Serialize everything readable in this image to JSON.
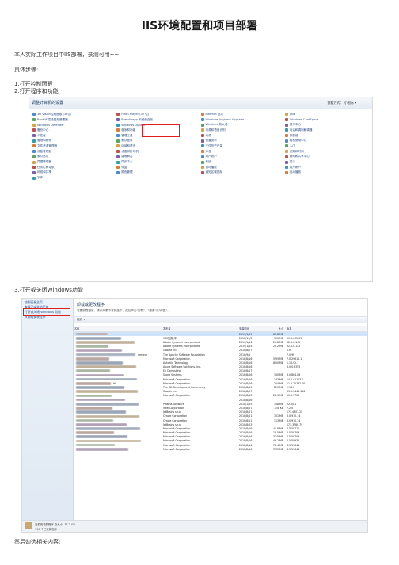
{
  "title": "IIS环境配置和项目部署",
  "paragraphs": {
    "intro": "本人实际工作项目中IIS部署，亲测可用~~",
    "steps_label": "具体步骤:",
    "step1": "1.打开控制面板",
    "step2": "2.打开程序和功能",
    "step3": "3.打开或关闭Windows功能",
    "step4": "然后勾选相关内容:"
  },
  "control_panel": {
    "header": "调整计算机的设置",
    "view_by": "查看方式：   小图标 ▾",
    "columns": [
      [
        "3D Vision控制面板 (32位)",
        "BootIM 高级图形管理器",
        "Windows Defender",
        "备份中心",
        "个性化",
        "管理和维修",
        "文件资源管理器",
        "设备管理器",
        "索引选项",
        "凭据管理器",
        "任务栏和导航",
        "网络和共享",
        "字体"
      ],
      [
        "Flash Player (32 位)",
        "Remoteapp 和桌面连接",
        "Windows Update",
        "程序和功能",
        "管理工具",
        "默认程序",
        "区域和语言",
        "设备和打印机",
        "疑难解答",
        "同步中心",
        "恢复",
        "颜色管理"
      ],
      [
        "Internet 选项",
        "Windows Anytime Upgrade",
        "Windows 防火墙",
        "电源和语音识别",
        "电源",
        "设置提示",
        "文件历史记录",
        "声音",
        "用户帐户",
        "系统",
        "自动播放",
        "通知区域图标"
      ],
      [
        "Java",
        "Windows CardSpace",
        "操作中心",
        "电话和调制解调器",
        "家庭组",
        "轻松使用中心",
        "入门",
        "日期和时间",
        "网络和共享中心",
        "显示",
        "用户帐户",
        "自动播放"
      ]
    ]
  },
  "programs": {
    "sidebar": [
      "控制面板主页",
      "查看已安装的更新",
      "打开或关闭 Windows 功能",
      "从网络安装程序"
    ],
    "heading": "卸载或更改程序",
    "subtitle": "若要卸载程序，请从列表中将其选中，然后单击\"卸载\"、\"更改\"或\"修复\"。",
    "toolbar": "组织 ▾",
    "headers": [
      "名称",
      "发布者",
      "安装时间",
      "大小",
      "版本"
    ],
    "rows": [
      [
        "",
        "",
        "2019/1/29",
        "85.8 MB",
        ""
      ],
      [
        "",
        "360压缩(中)",
        "2018/11/5",
        "101 MB",
        "11.5.0.2001"
      ],
      [
        "",
        "Adobe Systems Incorporated",
        "2019/1/14",
        "29.8 MB",
        "32.0.0.142"
      ],
      [
        "",
        "Adobe Systems Incorporated",
        "2019/1/14",
        "20.2 MB",
        "32.0.0.142"
      ],
      [
        "",
        "Google Inc.",
        "2018/8/27",
        "",
        "1.0"
      ],
      [
        "remove",
        "The Apache Software Foundation",
        "2018/9/2",
        "",
        "7.0.90"
      ],
      [
        "",
        "Microsoft Corporation",
        "2018/8/16",
        "5.95 MB",
        "7.0.29612.1"
      ],
      [
        "",
        "Ashwilla Technology",
        "2018/8/16",
        "8.00 MB",
        "1.16.92.1"
      ],
      [
        "",
        "Axure Software Solutions, Inc.",
        "2018/8/16",
        "",
        "8.0.0.3355"
      ],
      [
        "",
        "Eh Computing",
        "2018/8/17",
        "",
        ""
      ],
      [
        "",
        "Sparx Systems",
        "2018/8/16",
        "100 MB",
        "8.0.864.08"
      ],
      [
        "",
        "Microsoft Corporation",
        "2018/8/16",
        "143 MB",
        "14.0.41103.0"
      ],
      [
        "HS",
        "Microsoft Corporation",
        "2018/8/16",
        "304 MB",
        "11.1.20792.00"
      ],
      [
        "",
        "The Git Development Community",
        "2018/8/29",
        "229 MB",
        "2.18.0"
      ],
      [
        "",
        "Google Inc.",
        "2018/8/27",
        "",
        "69.0.3445.106"
      ],
      [
        "",
        "Microsoft Corporation",
        "2018/8/16",
        "26.1 MB",
        "10.0.1700"
      ],
      [
        "",
        "",
        "2018/8/16",
        "",
        ""
      ],
      [
        "",
        "Plasma Software",
        "2018/1/25",
        "158 MB",
        "22.00.1"
      ],
      [
        "",
        "Intel Corporation",
        "2018/8/27",
        "434 KB",
        "7.2.0"
      ],
      [
        "",
        "JetBrains s.r.o.",
        "2018/8/21",
        "",
        "173.4301.25"
      ],
      [
        "",
        "Oracle Corporation",
        "2018/8/21",
        "101 MB",
        "8.0.910.14"
      ],
      [
        "",
        "Oracle Corporation",
        "2018/8/21",
        "313 MB",
        "8.0.910.14"
      ],
      [
        "",
        "JetBrains s.r.o.",
        "2018/8/23",
        "",
        "171.3780.79"
      ],
      [
        "",
        "Microsoft Corporation",
        "2018/8/16",
        "41.8 MB",
        "4.5.50710"
      ],
      [
        "",
        "Microsoft Corporation",
        "2018/8/16",
        "18.5 MB",
        "4.5.50709"
      ],
      [
        "",
        "Microsoft Corporation",
        "2018/8/16",
        "3.15 MB",
        "4.5.50709"
      ],
      [
        "",
        "Microsoft Corporation",
        "2018/8/16",
        "49.2 MB",
        "4.5.50932"
      ],
      [
        "",
        "Microsoft Corporation",
        "2018/8/16",
        "76.4 MB",
        "4.5.51641"
      ],
      [
        "",
        "Microsoft Corporation",
        "2018/8/16",
        "3.33 MB",
        "4.5.51641"
      ]
    ],
    "footer_line1": "当前安装的程序  总大小: 17.7 GB",
    "footer_line2": "118 个已安装程序"
  }
}
